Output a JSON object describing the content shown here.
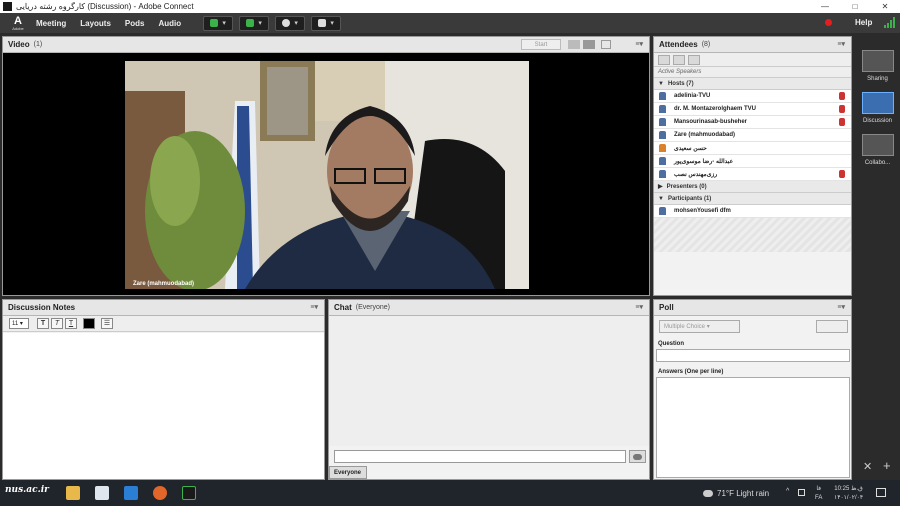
{
  "window": {
    "title": "کارگروه رشته دریایی (Discussion) - Adobe Connect",
    "controls": [
      "—",
      "□",
      "✕"
    ]
  },
  "menubar": {
    "logo_text": "Adobe",
    "items": [
      "Meeting",
      "Layouts",
      "Pods",
      "Audio"
    ],
    "help": "Help",
    "record_color": "#e02020"
  },
  "video_pod": {
    "title": "Video",
    "count": "(1)",
    "start_label": "Start",
    "speaker_label": "Zare (mahmuodabad)"
  },
  "attendees_pod": {
    "title": "Attendees",
    "count": "(8)",
    "active_speakers": "Active Speakers",
    "hosts_label": "Hosts (7)",
    "hosts": [
      {
        "name": "adelinia-TVU",
        "mic": true
      },
      {
        "name": "dr. M. Montazerolghaem TVU",
        "mic": true
      },
      {
        "name": "Mansourinasab-busheher",
        "mic": true
      },
      {
        "name": "Zare (mahmuodabad)",
        "mic": false
      },
      {
        "name": "حسن سعیدی",
        "mic": false
      },
      {
        "name": "عبدالله -رضا موسوی‌پور",
        "mic": false
      },
      {
        "name": "رزی‌مهندس نصب",
        "mic": true
      }
    ],
    "presenters_label": "Presenters (0)",
    "participants_label": "Participants (1)",
    "participants": [
      {
        "name": "mohsenYousefi dfm"
      }
    ]
  },
  "right_rail": {
    "layouts": [
      "Sharing",
      "Discussion",
      "Collabo..."
    ]
  },
  "notes_pod": {
    "title": "Discussion Notes",
    "font_size": "11"
  },
  "chat_pod": {
    "title": "Chat",
    "scope": "(Everyone)",
    "tab_label": "Everyone"
  },
  "poll_pod": {
    "title": "Poll",
    "type_select": "Multiple Choice",
    "question_label": "Question",
    "answers_label": "Answers (One per line)"
  },
  "taskbar": {
    "watermark": "nus.ac.ir",
    "weather": "71°F  Light rain",
    "language": "فا",
    "language_sub": "FA",
    "time": "10:25 ق.ظ",
    "date": "۱۴۰۱/۰۲/۰۴"
  }
}
